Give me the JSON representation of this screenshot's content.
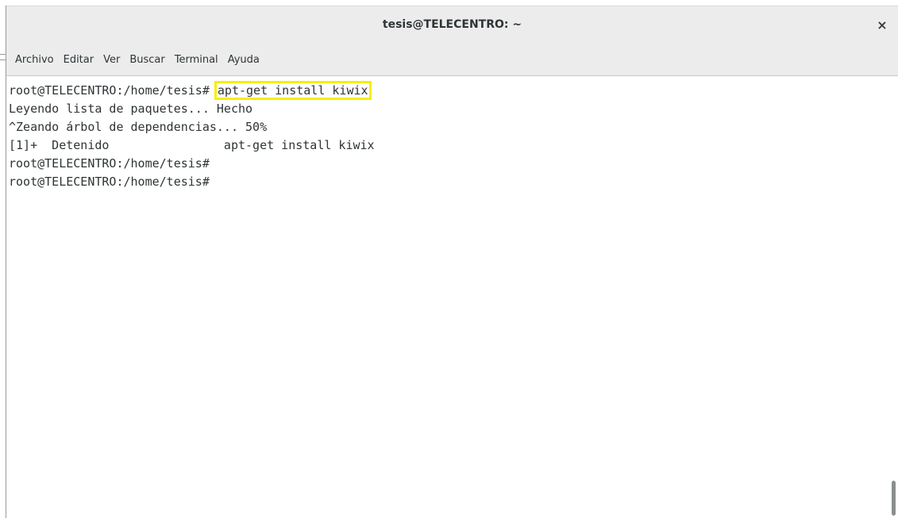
{
  "window": {
    "title": "tesis@TELECENTRO: ~",
    "close_glyph": "×"
  },
  "menu": [
    "Archivo",
    "Editar",
    "Ver",
    "Buscar",
    "Terminal",
    "Ayuda"
  ],
  "terminal": {
    "highlight_color": "#f5ef00",
    "lines": [
      {
        "prompt": "root@TELECENTRO:/home/tesis# ",
        "command": "apt-get install kiwix"
      },
      {
        "text": "Leyendo lista de paquetes... Hecho"
      },
      {
        "text": "^Zeando árbol de dependencias... 50%"
      },
      {
        "text": "[1]+  Detenido                apt-get install kiwix"
      },
      {
        "text": "root@TELECENTRO:/home/tesis#"
      },
      {
        "text": "root@TELECENTRO:/home/tesis#"
      }
    ]
  }
}
